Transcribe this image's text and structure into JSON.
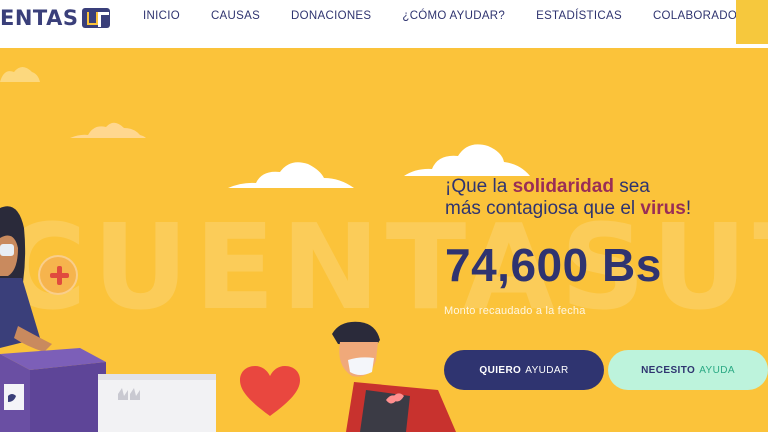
{
  "brand": {
    "logo_text": "ENTAS"
  },
  "nav": {
    "items": [
      {
        "label": "INICIO"
      },
      {
        "label": "CAUSAS"
      },
      {
        "label": "DONACIONES"
      },
      {
        "label": "¿CÓMO AYUDAR?"
      },
      {
        "label": "ESTADÍSTICAS"
      },
      {
        "label": "COLABORADORES"
      }
    ]
  },
  "hero": {
    "watermark": "CUENTASUT",
    "tagline": {
      "part1": "¡Que la ",
      "highlight1": "solidaridad",
      "part2": " sea",
      "part3": "más contagiosa que el ",
      "highlight2": "virus",
      "part4": "!"
    },
    "amount": "74,600 Bs",
    "amount_label": "Monto recaudado a la fecha",
    "buttons": {
      "help_strong": "QUIERO",
      "help_soft": "AYUDAR",
      "need_strong": "NECESITO",
      "need_soft": "AYUDA"
    }
  },
  "colors": {
    "background": "#fbc33a",
    "navy": "#2f3470",
    "highlight": "#9a2e56",
    "mint": "#bdf3dc",
    "heart": "#e9473f"
  },
  "icons": [
    "plus-icon",
    "heart-icon",
    "hearts-icon"
  ]
}
